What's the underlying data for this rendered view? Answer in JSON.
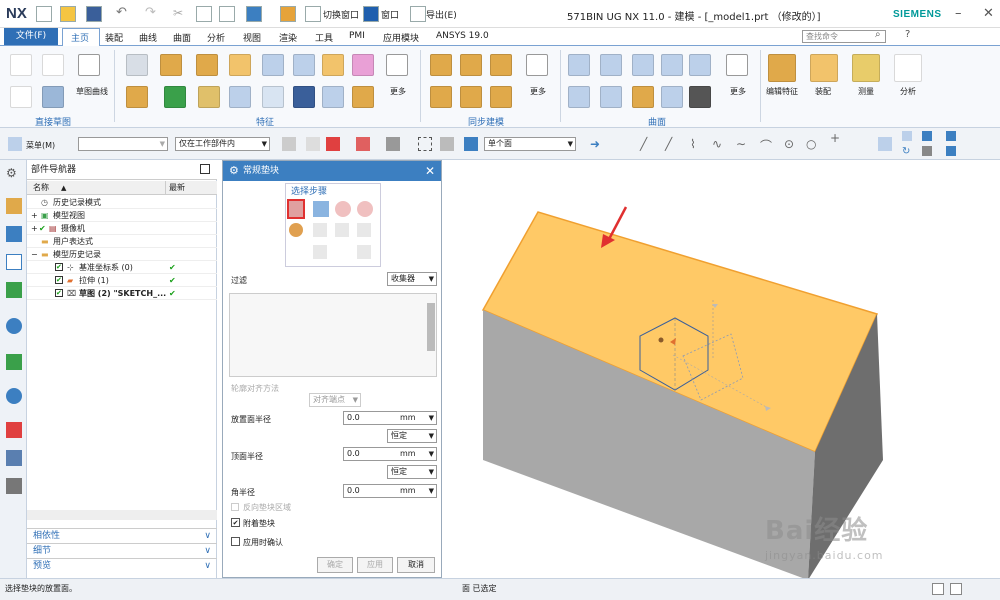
{
  "app": {
    "logo": "NX",
    "title": "571BIN UG NX 11.0 - 建模 - [_model1.prt （修改的）]",
    "brand": "SIEMENS"
  },
  "quick_access": {
    "switch_window": "切换窗口",
    "window": "窗口",
    "export": "导出(E)"
  },
  "menu": {
    "file": "文件(F)",
    "tabs": [
      "主页",
      "装配",
      "曲线",
      "曲面",
      "分析",
      "视图",
      "渲染",
      "工具",
      "PMI",
      "应用模块",
      "ANSYS 19.0"
    ],
    "search_placeholder": "查找命令"
  },
  "ribbon": {
    "groups": [
      "直接草图",
      "特征",
      "同步建模",
      "曲面"
    ],
    "labels": {
      "sketch_curve": "草图曲线",
      "more1": "更多",
      "more2": "更多",
      "more3": "更多",
      "edit_feature": "编辑特征",
      "assembly": "装配",
      "measure": "测量",
      "analysis": "分析"
    }
  },
  "toolbar": {
    "menu": "菜单(M)",
    "filter_value": "",
    "scope": "仅在工作部件内",
    "face_rule": "单个面"
  },
  "navigator": {
    "title": "部件导航器",
    "col_name": "名称",
    "col_latest": "最新",
    "items": [
      {
        "label": "历史记录模式"
      },
      {
        "label": "模型视图"
      },
      {
        "label": "摄像机"
      },
      {
        "label": "用户表达式"
      },
      {
        "label": "模型历史记录"
      },
      {
        "label": "基准坐标系 (0)"
      },
      {
        "label": "拉伸 (1)"
      },
      {
        "label": "草图 (2) \"SKETCH_..."
      }
    ],
    "sections": [
      "相依性",
      "细节",
      "预览"
    ]
  },
  "dialog": {
    "title": "常规垫块",
    "step_label": "选择步骤",
    "filter_label": "过滤",
    "filter_value": "收集器",
    "contour_label": "轮廓对齐方法",
    "contour_value": "对齐端点",
    "place_radius_label": "放置面半径",
    "place_radius_value": "0.0",
    "top_radius_label": "顶面半径",
    "top_radius_value": "0.0",
    "corner_radius_label": "角半径",
    "corner_radius_value": "0.0",
    "unit": "mm",
    "constant": "恒定",
    "reverse_label": "反向垫块区域",
    "attach_label": "附着垫块",
    "confirm_label": "应用时确认",
    "ok": "确定",
    "apply": "应用",
    "cancel": "取消"
  },
  "status": {
    "left": "选择垫块的放置面。",
    "mid": "面 已选定"
  },
  "watermark": {
    "brand": "Bai经验",
    "url": "jingyan.baidu.com"
  },
  "colors": {
    "accent": "#2f6fb6",
    "face": "#ffc966",
    "face_edge": "#f0a030",
    "side_dark": "#6e6e6e",
    "side_mid": "#a8a8a8",
    "check": "#1aa01a",
    "highlight": "#e03030"
  }
}
